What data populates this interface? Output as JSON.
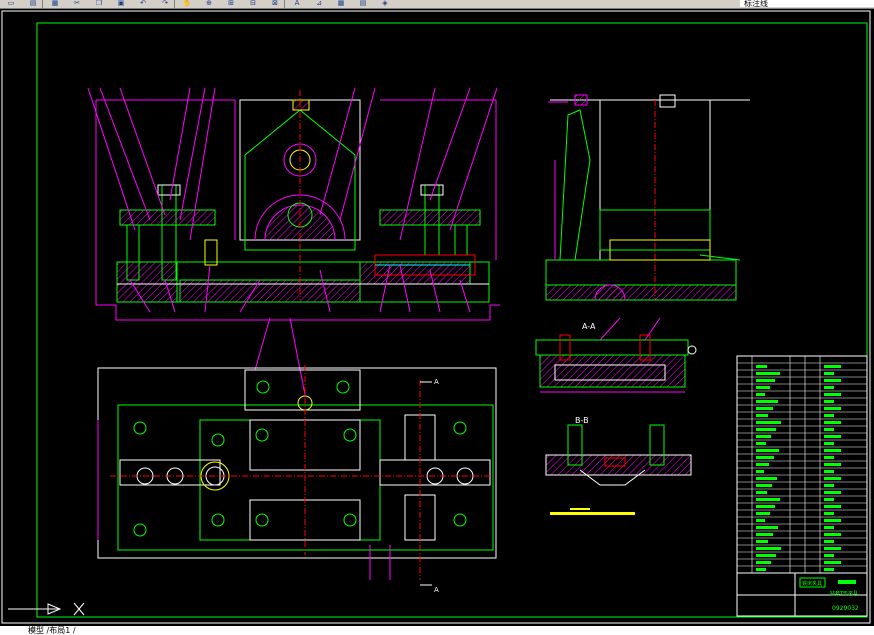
{
  "toolbar": {
    "buttons": [
      "new-file-icon",
      "save-icon",
      "print-icon",
      "cut-icon",
      "copy-icon",
      "paste-icon",
      "undo-icon",
      "redo-icon",
      "pan-icon",
      "zoom-realtime-icon",
      "zoom-window-icon",
      "zoom-previous-icon",
      "zoom-extents-icon",
      "text-style-icon",
      "dim-style-icon",
      "table-icon",
      "properties-icon",
      "layer-icon"
    ],
    "layer_name": "标注线",
    "colors": {
      "bg": "#d4d0c8",
      "icon": "#1a3c8a"
    }
  },
  "drawing": {
    "colors": {
      "background": "#000000",
      "frame": "#00ff00",
      "outline": "#ffffff",
      "part_green": "#00ff00",
      "dimension": "#ff00ff",
      "centerline": "#ff0000",
      "hatch": "#ff00ff",
      "leader": "#ff00ff",
      "yellow": "#ffff00",
      "cyan": "#00ffff"
    },
    "section_labels": {
      "a_a": "A-A",
      "b_b": "B-B",
      "cut_a_top": "A",
      "cut_a_bottom": "A"
    },
    "title_block": {
      "stamp": "铣床夹具",
      "name": "钻套T形夹具",
      "drawing_no": "0929032"
    }
  },
  "commandline": {
    "text": "模型 /布局1 /"
  }
}
